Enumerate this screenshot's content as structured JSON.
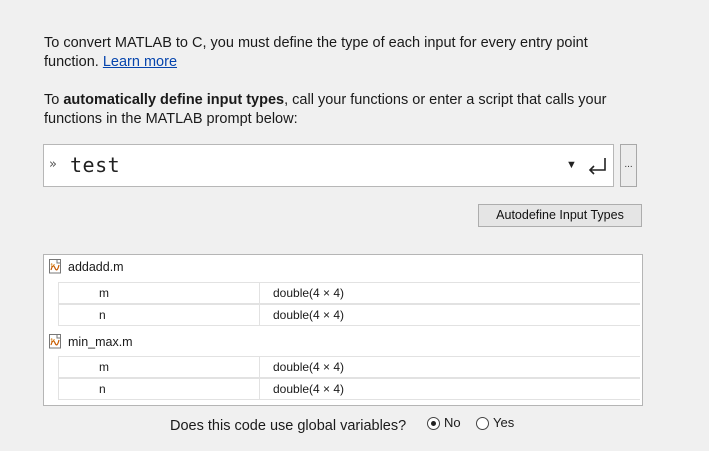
{
  "intro": {
    "text": "To convert MATLAB to C, you must define the type of each input for every entry point function.",
    "link": "Learn more"
  },
  "auto_define": {
    "prefix": "To ",
    "bold": "automatically define input types",
    "suffix": ", call your functions or enter a script that calls your functions in the MATLAB prompt below:"
  },
  "command": {
    "prompt": "»",
    "value": "test",
    "dropdown_glyph": "▼",
    "more_label": "..."
  },
  "autodefine_button": "Autodefine Input Types",
  "files": [
    {
      "name": "addadd.m",
      "inputs": [
        {
          "name": "m",
          "type": "double(4 × 4)"
        },
        {
          "name": "n",
          "type": "double(4 × 4)"
        }
      ]
    },
    {
      "name": "min_max.m",
      "inputs": [
        {
          "name": "m",
          "type": "double(4 × 4)"
        },
        {
          "name": "n",
          "type": "double(4 × 4)"
        }
      ]
    }
  ],
  "globals": {
    "question": "Does this code use global variables?",
    "options": [
      {
        "label": "No",
        "selected": true
      },
      {
        "label": "Yes",
        "selected": false
      }
    ]
  }
}
